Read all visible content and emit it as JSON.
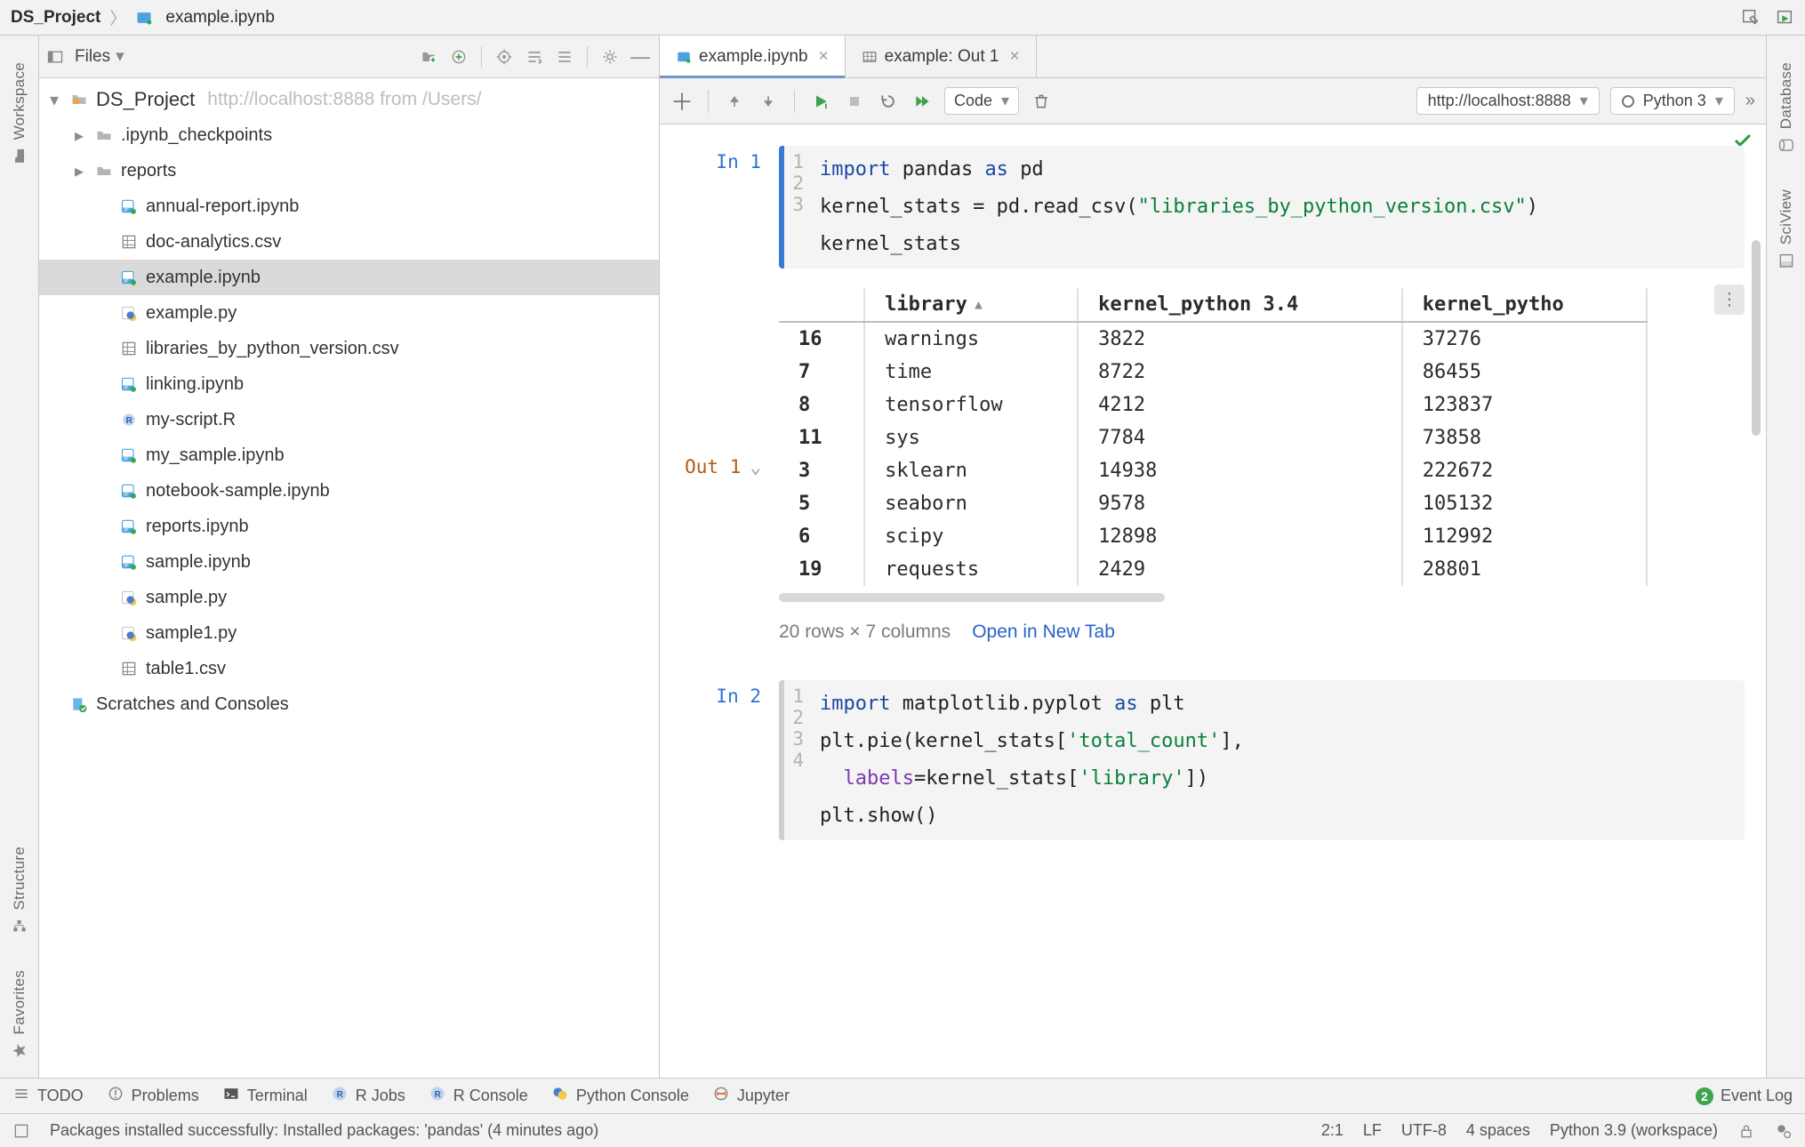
{
  "breadcrumbs": {
    "project": "DS_Project",
    "file": "example.ipynb"
  },
  "titlebar_icons": [
    "edit-icon",
    "run-dashboard-icon"
  ],
  "rails": {
    "left": [
      {
        "label": "Workspace",
        "icon": "folder-icon"
      },
      {
        "label": "Structure",
        "icon": "structure-icon"
      },
      {
        "label": "Favorites",
        "icon": "star-icon"
      }
    ],
    "right": [
      {
        "label": "Database",
        "icon": "database-icon"
      },
      {
        "label": "SciView",
        "icon": "sciview-icon"
      }
    ]
  },
  "project_toolbar": {
    "selector": "Files",
    "buttons": [
      "new-file-icon",
      "new-folder-icon",
      "sync-icon",
      "target-icon",
      "expand-icon",
      "collapse-icon",
      "gear-icon",
      "hide-icon"
    ]
  },
  "tree_root": {
    "label": "DS_Project",
    "hint": "http://localhost:8888 from /Users/"
  },
  "tree": [
    {
      "indent": 1,
      "type": "folder",
      "arrow": "right",
      "label": ".ipynb_checkpoints"
    },
    {
      "indent": 1,
      "type": "folder",
      "arrow": "right",
      "label": "reports"
    },
    {
      "indent": 2,
      "type": "ipynb",
      "label": "annual-report.ipynb"
    },
    {
      "indent": 2,
      "type": "csv",
      "label": "doc-analytics.csv"
    },
    {
      "indent": 2,
      "type": "ipynb",
      "label": "example.ipynb",
      "selected": true
    },
    {
      "indent": 2,
      "type": "py",
      "label": "example.py"
    },
    {
      "indent": 2,
      "type": "csv",
      "label": "libraries_by_python_version.csv"
    },
    {
      "indent": 2,
      "type": "ipynb",
      "label": "linking.ipynb"
    },
    {
      "indent": 2,
      "type": "r",
      "label": "my-script.R"
    },
    {
      "indent": 2,
      "type": "ipynb",
      "label": "my_sample.ipynb"
    },
    {
      "indent": 2,
      "type": "ipynb",
      "label": "notebook-sample.ipynb"
    },
    {
      "indent": 2,
      "type": "ipynb",
      "label": "reports.ipynb"
    },
    {
      "indent": 2,
      "type": "ipynb",
      "label": "sample.ipynb"
    },
    {
      "indent": 2,
      "type": "py",
      "label": "sample.py"
    },
    {
      "indent": 2,
      "type": "py",
      "label": "sample1.py"
    },
    {
      "indent": 2,
      "type": "csv",
      "label": "table1.csv"
    }
  ],
  "scratches_label": "Scratches and Consoles",
  "tabs": [
    {
      "label": "example.ipynb",
      "icon": "ipynb",
      "active": true
    },
    {
      "label": "example: Out 1",
      "icon": "table",
      "active": false
    }
  ],
  "nb_toolbar": {
    "cell_type": "Code",
    "server": "http://localhost:8888",
    "kernel": "Python 3"
  },
  "cell1": {
    "label": "In 1",
    "lines": [
      [
        {
          "t": "import ",
          "c": "kw"
        },
        {
          "t": "pandas ",
          "c": "id"
        },
        {
          "t": "as ",
          "c": "kw"
        },
        {
          "t": "pd",
          "c": "id"
        }
      ],
      [
        {
          "t": "kernel_stats = pd.read_csv(",
          "c": "id"
        },
        {
          "t": "\"libraries_by_python_version.csv\"",
          "c": "str"
        },
        {
          "t": ")",
          "c": "id"
        }
      ],
      [
        {
          "t": "kernel_stats",
          "c": "id"
        }
      ]
    ]
  },
  "out1": {
    "label": "Out 1",
    "headers": [
      "",
      "library",
      "kernel_python 3.4",
      "kernel_pytho"
    ],
    "sort_col": 1,
    "rows": [
      [
        "16",
        "warnings",
        "3822",
        "37276"
      ],
      [
        "7",
        "time",
        "8722",
        "86455"
      ],
      [
        "8",
        "tensorflow",
        "4212",
        "123837"
      ],
      [
        "11",
        "sys",
        "7784",
        "73858"
      ],
      [
        "3",
        "sklearn",
        "14938",
        "222672"
      ],
      [
        "5",
        "seaborn",
        "9578",
        "105132"
      ],
      [
        "6",
        "scipy",
        "12898",
        "112992"
      ],
      [
        "19",
        "requests",
        "2429",
        "28801"
      ]
    ],
    "shape": "20 rows × 7 columns",
    "open_link": "Open in New Tab"
  },
  "cell2": {
    "label": "In 2",
    "lines": [
      [
        {
          "t": "import ",
          "c": "kw"
        },
        {
          "t": "matplotlib.pyplot ",
          "c": "id"
        },
        {
          "t": "as ",
          "c": "kw"
        },
        {
          "t": "plt",
          "c": "id"
        }
      ],
      [
        {
          "t": "plt.pie(kernel_stats[",
          "c": "id"
        },
        {
          "t": "'total_count'",
          "c": "str"
        },
        {
          "t": "],",
          "c": "id"
        }
      ],
      [
        {
          "t": "  ",
          "c": "id"
        },
        {
          "t": "labels",
          "c": "param"
        },
        {
          "t": "=kernel_stats[",
          "c": "id"
        },
        {
          "t": "'library'",
          "c": "str"
        },
        {
          "t": "])",
          "c": "id"
        }
      ],
      [
        {
          "t": "plt.show()",
          "c": "id"
        }
      ]
    ]
  },
  "bottom_bar": {
    "items": [
      "TODO",
      "Problems",
      "Terminal",
      "R Jobs",
      "R Console",
      "Python Console",
      "Jupyter"
    ],
    "event_log": "Event Log",
    "event_count": "2"
  },
  "status_bar": {
    "msg": "Packages installed successfully: Installed packages: 'pandas' (4 minutes ago)",
    "pos": "2:1",
    "line_sep": "LF",
    "encoding": "UTF-8",
    "indent": "4 spaces",
    "interpreter": "Python 3.9 (workspace)"
  }
}
